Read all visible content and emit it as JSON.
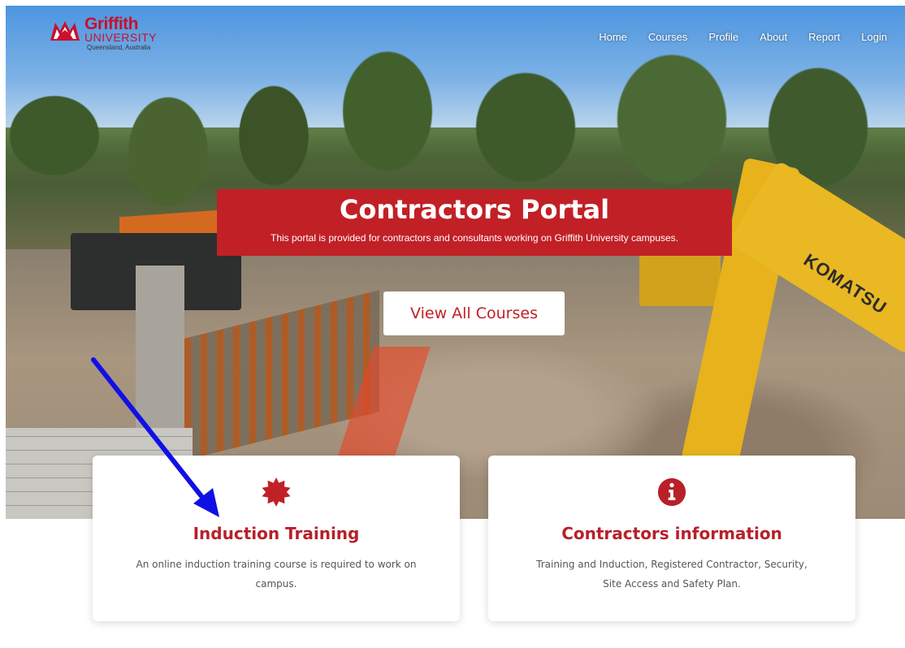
{
  "logo": {
    "name": "Griffith",
    "university": "UNIVERSITY",
    "tagline": "Queensland, Australia"
  },
  "nav": {
    "items": [
      "Home",
      "Courses",
      "Profile",
      "About",
      "Report",
      "Login"
    ]
  },
  "hero": {
    "title": "Contractors Portal",
    "subtitle": "This portal is provided for contractors and consultants working on Griffith University campuses.",
    "cta_label": "View All Courses",
    "machine_brand": "KOMATSU"
  },
  "cards": [
    {
      "icon": "badge-icon",
      "title": "Induction Training",
      "text": "An online induction training course is required to work on campus."
    },
    {
      "icon": "info-icon",
      "title": "Contractors information",
      "text": "Training and Induction, Registered Contractor, Security, Site Access and Safety Plan."
    }
  ],
  "colors": {
    "brand_red": "#c12026",
    "arrow_blue": "#1010e6"
  }
}
